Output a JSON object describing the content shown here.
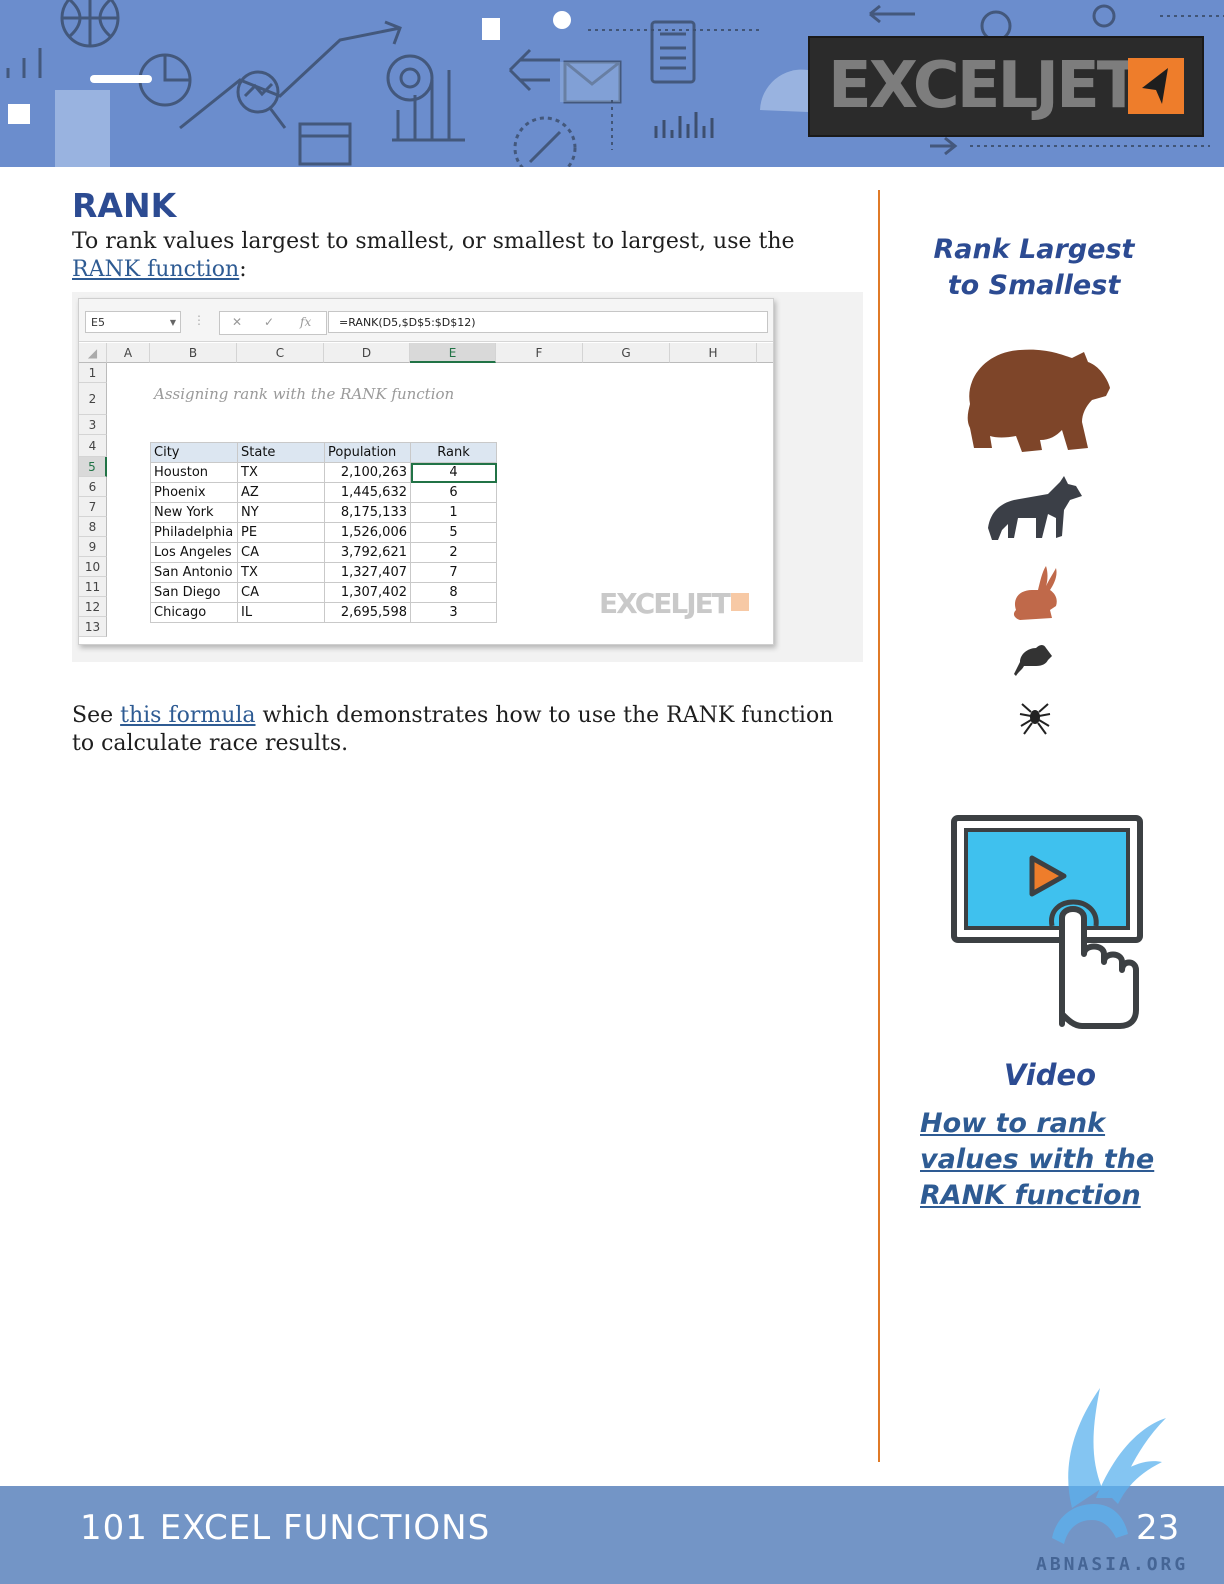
{
  "banner": {
    "logo_text": "EXCELJET"
  },
  "page": {
    "title": "RANK",
    "intro_before": "To rank values largest to smallest, or smallest to largest, use the ",
    "intro_link": "RANK function",
    "intro_after": ":",
    "see_before": "See ",
    "see_link": "this formula",
    "see_after": " which demonstrates how to use the RANK function to calculate race results."
  },
  "spreadsheet": {
    "name_box": "E5",
    "formula": "=RANK(D5,$D$5:$D$12)",
    "fx_label": "fx",
    "columns": [
      "A",
      "B",
      "C",
      "D",
      "E",
      "F",
      "G",
      "H"
    ],
    "rows": [
      "1",
      "2",
      "3",
      "4",
      "5",
      "6",
      "7",
      "8",
      "9",
      "10",
      "11",
      "12",
      "13"
    ],
    "sheet_title": "Assigning rank with the RANK function",
    "headers": [
      "City",
      "State",
      "Population",
      "Rank"
    ],
    "data": [
      [
        "Houston",
        "TX",
        "2,100,263",
        "4"
      ],
      [
        "Phoenix",
        "AZ",
        "1,445,632",
        "6"
      ],
      [
        "New York",
        "NY",
        "8,175,133",
        "1"
      ],
      [
        "Philadelphia",
        "PE",
        "1,526,006",
        "5"
      ],
      [
        "Los Angeles",
        "CA",
        "3,792,621",
        "2"
      ],
      [
        "San Antonio",
        "TX",
        "1,327,407",
        "7"
      ],
      [
        "San Diego",
        "CA",
        "1,307,402",
        "8"
      ],
      [
        "Chicago",
        "IL",
        "2,695,598",
        "3"
      ]
    ],
    "watermark": "EXCELJET"
  },
  "sidebar": {
    "title_line1": "Rank Largest",
    "title_line2": "to Smallest",
    "animals": [
      "bear-icon",
      "wolf-icon",
      "rabbit-icon",
      "mouse-icon",
      "spider-icon"
    ],
    "video_label": "Video",
    "video_link": "How to rank values with the RANK function"
  },
  "footer": {
    "title": "101 EXCEL FUNCTIONS",
    "page_number": "23"
  },
  "stamp": {
    "text": "ABNASIA.ORG"
  },
  "colors": {
    "accent": "#2c4b92",
    "link": "#2e5b93",
    "orange": "#e07a27",
    "banner": "#6b8dcd",
    "footer": "#7395c6"
  }
}
